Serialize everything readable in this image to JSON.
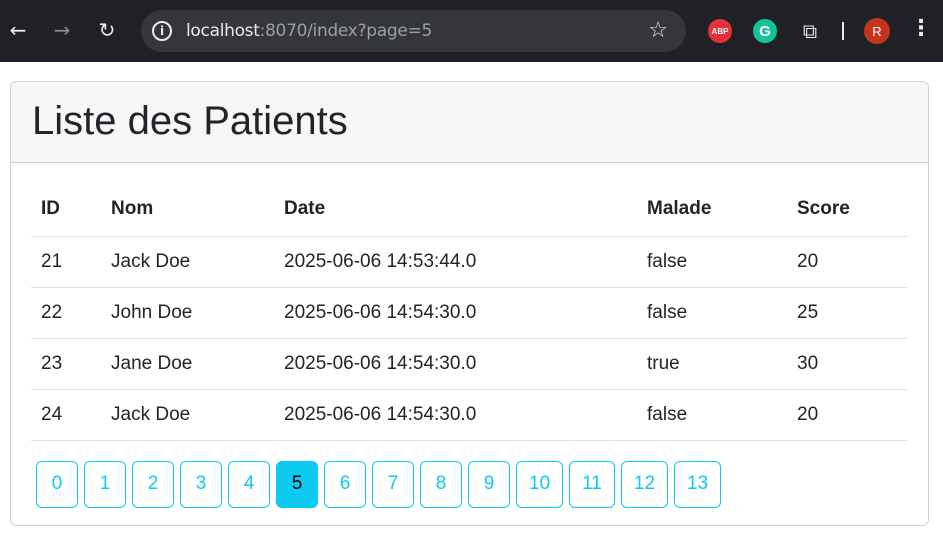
{
  "browser": {
    "url_host": "localhost",
    "url_rest": ":8070/index?page=5",
    "extensions": {
      "abp_label": "ABP",
      "grammarly_label": "G"
    },
    "profile_initial": "R"
  },
  "page": {
    "title": "Liste des Patients"
  },
  "table": {
    "headers": [
      "ID",
      "Nom",
      "Date",
      "Malade",
      "Score"
    ],
    "rows": [
      [
        "21",
        "Jack Doe",
        "2025-06-06 14:53:44.0",
        "false",
        "20"
      ],
      [
        "22",
        "John Doe",
        "2025-06-06 14:54:30.0",
        "false",
        "25"
      ],
      [
        "23",
        "Jane Doe",
        "2025-06-06 14:54:30.0",
        "true",
        "30"
      ],
      [
        "24",
        "Jack Doe",
        "2025-06-06 14:54:30.0",
        "false",
        "20"
      ]
    ]
  },
  "pagination": {
    "pages": [
      "0",
      "1",
      "2",
      "3",
      "4",
      "5",
      "6",
      "7",
      "8",
      "9",
      "10",
      "11",
      "12",
      "13"
    ],
    "current": "5"
  },
  "colors": {
    "accent": "#0dcaf0",
    "chrome_bg": "#202124",
    "header_bg": "#f7f7f7",
    "text": "#212529"
  },
  "icons": [
    "back-arrow-icon",
    "forward-arrow-icon",
    "reload-icon",
    "info-icon",
    "star-icon",
    "puzzle-icon",
    "kebab-menu-icon"
  ]
}
